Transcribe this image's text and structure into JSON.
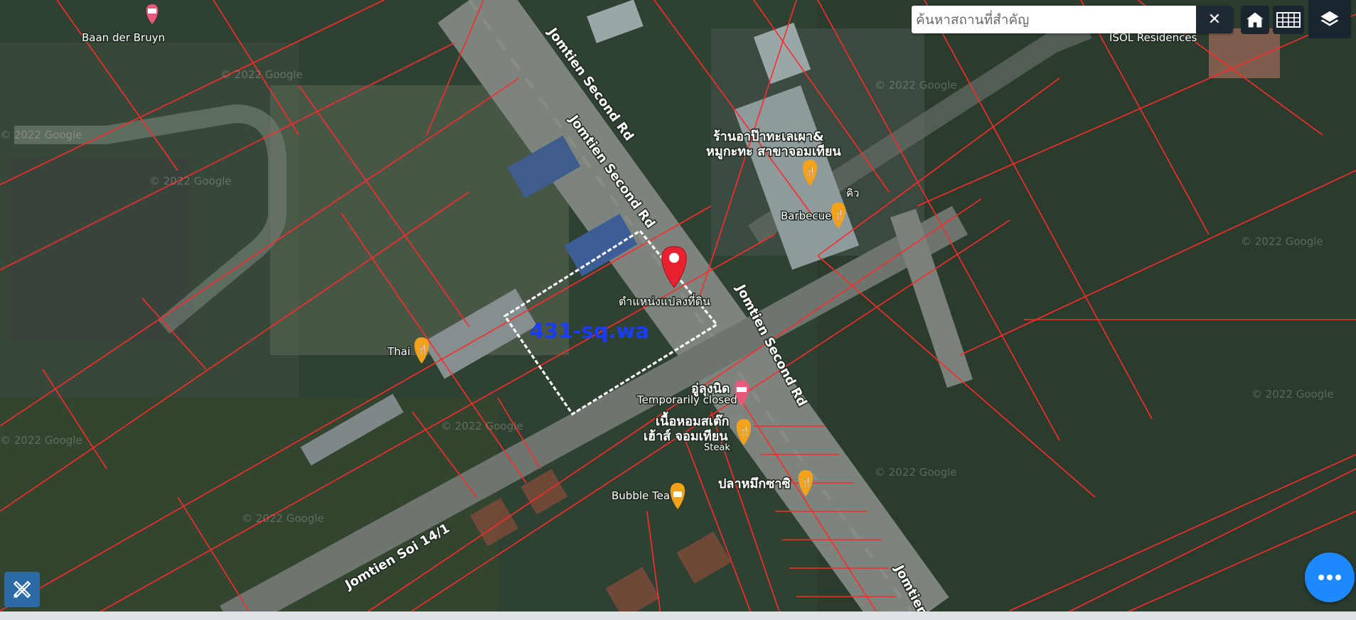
{
  "search": {
    "placeholder": "ค้นหาสถานที่สำคัญ",
    "clear_label": "✕"
  },
  "plot": {
    "label": "431-sq.wa",
    "pin_caption": "ตำแหน่งแปลงที่ดิน"
  },
  "roads": [
    {
      "id": "r1",
      "text": "Jomtien Second Rd"
    },
    {
      "id": "r2",
      "text": "Jomtien Second Rd"
    },
    {
      "id": "r3",
      "text": "Jomtien Second Rd"
    },
    {
      "id": "r4",
      "text": "Jomtien Soi 14/1"
    },
    {
      "id": "r5",
      "text": "Jomtien"
    }
  ],
  "places": [
    {
      "id": "baan",
      "name": "Baan der Bruyn"
    },
    {
      "id": "isol",
      "name": "ISOL Residences"
    },
    {
      "id": "seafood1",
      "name": "ร้านอาป๊าทะเลเผา&"
    },
    {
      "id": "seafood2",
      "name": "หมูกะทะ สาขาจอมเทียน"
    },
    {
      "id": "khew",
      "name": "คิว"
    },
    {
      "id": "bbq",
      "name": "Barbecue"
    },
    {
      "id": "thai",
      "name": "Thai"
    },
    {
      "id": "yulong",
      "name": "อู่ลุงนิด"
    },
    {
      "id": "closed",
      "name": "Temporarily closed"
    },
    {
      "id": "steak1",
      "name": "เนื้อหอมสเต๊ก"
    },
    {
      "id": "steak2",
      "name": "เฮ้าส์ จอมเทียน"
    },
    {
      "id": "steak3",
      "name": "Steak"
    },
    {
      "id": "squid",
      "name": "ปลาหมึกซาซิ"
    },
    {
      "id": "bubble",
      "name": "Bubble Tea"
    }
  ],
  "watermarks": [
    {
      "id": "w1",
      "text": "© 2022 Google"
    },
    {
      "id": "w2",
      "text": "© 2022 Google"
    },
    {
      "id": "w3",
      "text": "© 2022 Google"
    },
    {
      "id": "w4",
      "text": "© 2022 Google"
    },
    {
      "id": "w5",
      "text": "© 2022 Google"
    },
    {
      "id": "w6",
      "text": "© 2022 Google"
    },
    {
      "id": "w7",
      "text": "© 2022 Google"
    },
    {
      "id": "w8",
      "text": "© 2022 Google"
    },
    {
      "id": "w9",
      "text": "© 2022 Google"
    },
    {
      "id": "w10",
      "text": "© 2022 Google"
    }
  ],
  "icons": {
    "home": "home-icon",
    "grid": "grid-icon",
    "layers": "layers-icon",
    "more": "more-icon",
    "tool": "ruler-pencil-icon",
    "pin": "map-pin-icon"
  },
  "colors": {
    "parcel_lines": "#ff2a2a",
    "plot_label": "#1a3cff",
    "pin": "#e8202f",
    "poi_food": "#f3a21b",
    "fab": "#1e88ff",
    "control_bg": "#1b2530"
  }
}
